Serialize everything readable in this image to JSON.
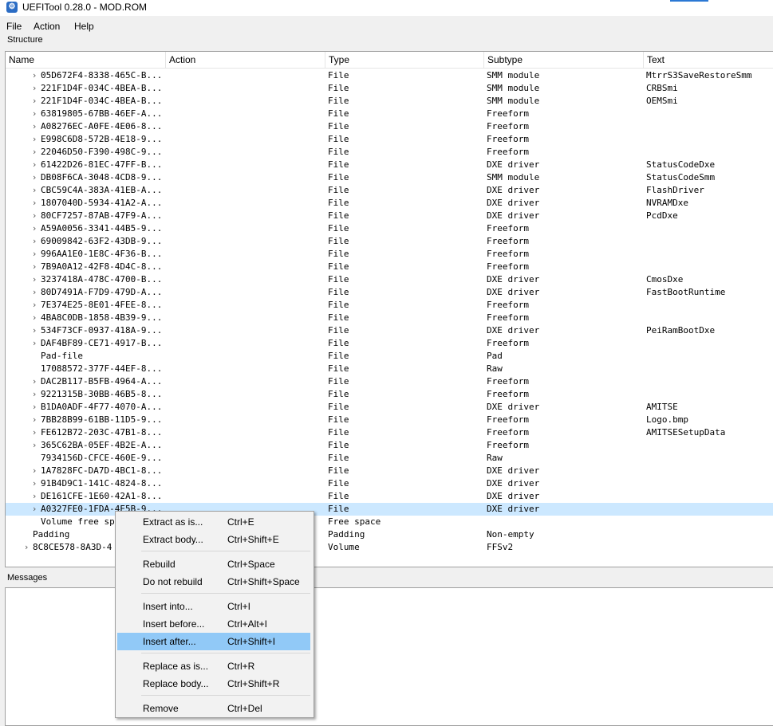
{
  "window": {
    "title": "UEFITool 0.28.0 - MOD.ROM"
  },
  "menubar": {
    "file": "File",
    "action": "Action",
    "help": "Help"
  },
  "structure": {
    "label": "Structure",
    "columns": {
      "name": "Name",
      "action": "Action",
      "type": "Type",
      "subtype": "Subtype",
      "text": "Text"
    },
    "rows": [
      {
        "name": "05D672F4-8338-465C-B...",
        "action": "",
        "type": "File",
        "subtype": "SMM module",
        "text": "MtrrS3SaveRestoreSmm"
      },
      {
        "name": "221F1D4F-034C-4BEA-B...",
        "action": "",
        "type": "File",
        "subtype": "SMM module",
        "text": "CRBSmi"
      },
      {
        "name": "221F1D4F-034C-4BEA-B...",
        "action": "",
        "type": "File",
        "subtype": "SMM module",
        "text": "OEMSmi"
      },
      {
        "name": "63819805-67BB-46EF-A...",
        "action": "",
        "type": "File",
        "subtype": "Freeform",
        "text": ""
      },
      {
        "name": "A08276EC-A0FE-4E06-8...",
        "action": "",
        "type": "File",
        "subtype": "Freeform",
        "text": ""
      },
      {
        "name": "E998C6D8-572B-4E18-9...",
        "action": "",
        "type": "File",
        "subtype": "Freeform",
        "text": ""
      },
      {
        "name": "22046D50-F390-498C-9...",
        "action": "",
        "type": "File",
        "subtype": "Freeform",
        "text": ""
      },
      {
        "name": "61422D26-81EC-47FF-B...",
        "action": "",
        "type": "File",
        "subtype": "DXE driver",
        "text": "StatusCodeDxe"
      },
      {
        "name": "DB08F6CA-3048-4CD8-9...",
        "action": "",
        "type": "File",
        "subtype": "SMM module",
        "text": "StatusCodeSmm"
      },
      {
        "name": "CBC59C4A-383A-41EB-A...",
        "action": "",
        "type": "File",
        "subtype": "DXE driver",
        "text": "FlashDriver"
      },
      {
        "name": "1807040D-5934-41A2-A...",
        "action": "",
        "type": "File",
        "subtype": "DXE driver",
        "text": "NVRAMDxe"
      },
      {
        "name": "80CF7257-87AB-47F9-A...",
        "action": "",
        "type": "File",
        "subtype": "DXE driver",
        "text": "PcdDxe"
      },
      {
        "name": "A59A0056-3341-44B5-9...",
        "action": "",
        "type": "File",
        "subtype": "Freeform",
        "text": ""
      },
      {
        "name": "69009842-63F2-43DB-9...",
        "action": "",
        "type": "File",
        "subtype": "Freeform",
        "text": ""
      },
      {
        "name": "996AA1E0-1E8C-4F36-B...",
        "action": "",
        "type": "File",
        "subtype": "Freeform",
        "text": ""
      },
      {
        "name": "7B9A0A12-42F8-4D4C-8...",
        "action": "",
        "type": "File",
        "subtype": "Freeform",
        "text": ""
      },
      {
        "name": "3237418A-478C-4700-B...",
        "action": "",
        "type": "File",
        "subtype": "DXE driver",
        "text": "CmosDxe"
      },
      {
        "name": "80D7491A-F7D9-479D-A...",
        "action": "",
        "type": "File",
        "subtype": "DXE driver",
        "text": "FastBootRuntime"
      },
      {
        "name": "7E374E25-8E01-4FEE-8...",
        "action": "",
        "type": "File",
        "subtype": "Freeform",
        "text": ""
      },
      {
        "name": "4BA8C0DB-1858-4B39-9...",
        "action": "",
        "type": "File",
        "subtype": "Freeform",
        "text": ""
      },
      {
        "name": "534F73CF-0937-418A-9...",
        "action": "",
        "type": "File",
        "subtype": "DXE driver",
        "text": "PeiRamBootDxe"
      },
      {
        "name": "DAF4BF89-CE71-4917-B...",
        "action": "",
        "type": "File",
        "subtype": "Freeform",
        "text": ""
      },
      {
        "name": "Pad-file",
        "action": "",
        "type": "File",
        "subtype": "Pad",
        "text": ""
      },
      {
        "name": "17088572-377F-44EF-8...",
        "action": "",
        "type": "File",
        "subtype": "Raw",
        "text": ""
      },
      {
        "name": "DAC2B117-B5FB-4964-A...",
        "action": "",
        "type": "File",
        "subtype": "Freeform",
        "text": ""
      },
      {
        "name": "9221315B-30BB-46B5-8...",
        "action": "",
        "type": "File",
        "subtype": "Freeform",
        "text": ""
      },
      {
        "name": "B1DA0ADF-4F77-4070-A...",
        "action": "",
        "type": "File",
        "subtype": "DXE driver",
        "text": "AMITSE"
      },
      {
        "name": "7BB28B99-61BB-11D5-9...",
        "action": "",
        "type": "File",
        "subtype": "Freeform",
        "text": "Logo.bmp"
      },
      {
        "name": "FE612B72-203C-47B1-8...",
        "action": "",
        "type": "File",
        "subtype": "Freeform",
        "text": "AMITSESetupData"
      },
      {
        "name": "365C62BA-05EF-4B2E-A...",
        "action": "",
        "type": "File",
        "subtype": "Freeform",
        "text": ""
      },
      {
        "name": "7934156D-CFCE-460E-9...",
        "action": "",
        "type": "File",
        "subtype": "Raw",
        "text": ""
      },
      {
        "name": "1A7828FC-DA7D-4BC1-8...",
        "action": "",
        "type": "File",
        "subtype": "DXE driver",
        "text": ""
      },
      {
        "name": "91B4D9C1-141C-4824-8...",
        "action": "",
        "type": "File",
        "subtype": "DXE driver",
        "text": ""
      },
      {
        "name": "DE161CFE-1E60-42A1-8...",
        "action": "",
        "type": "File",
        "subtype": "DXE driver",
        "text": ""
      },
      {
        "name": "A0327FE0-1FDA-4E5B-9...",
        "action": "",
        "type": "File",
        "subtype": "DXE driver",
        "text": ""
      },
      {
        "name": "Volume free sp",
        "action": "",
        "type": "Free space",
        "subtype": "",
        "text": ""
      },
      {
        "name": "Padding",
        "action": "",
        "type": "Padding",
        "subtype": "Non-empty",
        "text": ""
      },
      {
        "name": "8C8CE578-8A3D-4",
        "action": "",
        "type": "Volume",
        "subtype": "FFSv2",
        "text": ""
      }
    ]
  },
  "messages": {
    "label": "Messages"
  },
  "context_menu": {
    "items": [
      {
        "label": "Extract as is...",
        "shortcut": "Ctrl+E"
      },
      {
        "label": "Extract body...",
        "shortcut": "Ctrl+Shift+E"
      },
      {
        "label": "Rebuild",
        "shortcut": "Ctrl+Space"
      },
      {
        "label": "Do not rebuild",
        "shortcut": "Ctrl+Shift+Space"
      },
      {
        "label": "Insert into...",
        "shortcut": "Ctrl+I"
      },
      {
        "label": "Insert before...",
        "shortcut": "Ctrl+Alt+I"
      },
      {
        "label": "Insert after...",
        "shortcut": "Ctrl+Shift+I"
      },
      {
        "label": "Replace as is...",
        "shortcut": "Ctrl+R"
      },
      {
        "label": "Replace body...",
        "shortcut": "Ctrl+Shift+R"
      },
      {
        "label": "Remove",
        "shortcut": "Ctrl+Del"
      }
    ]
  },
  "icons": {
    "app": "uefitool-app-icon",
    "expand": "chevron-right-icon"
  },
  "colors": {
    "selection": "#cce8ff",
    "menu_highlight": "#91c9f7",
    "accent": "#2b78d4"
  }
}
